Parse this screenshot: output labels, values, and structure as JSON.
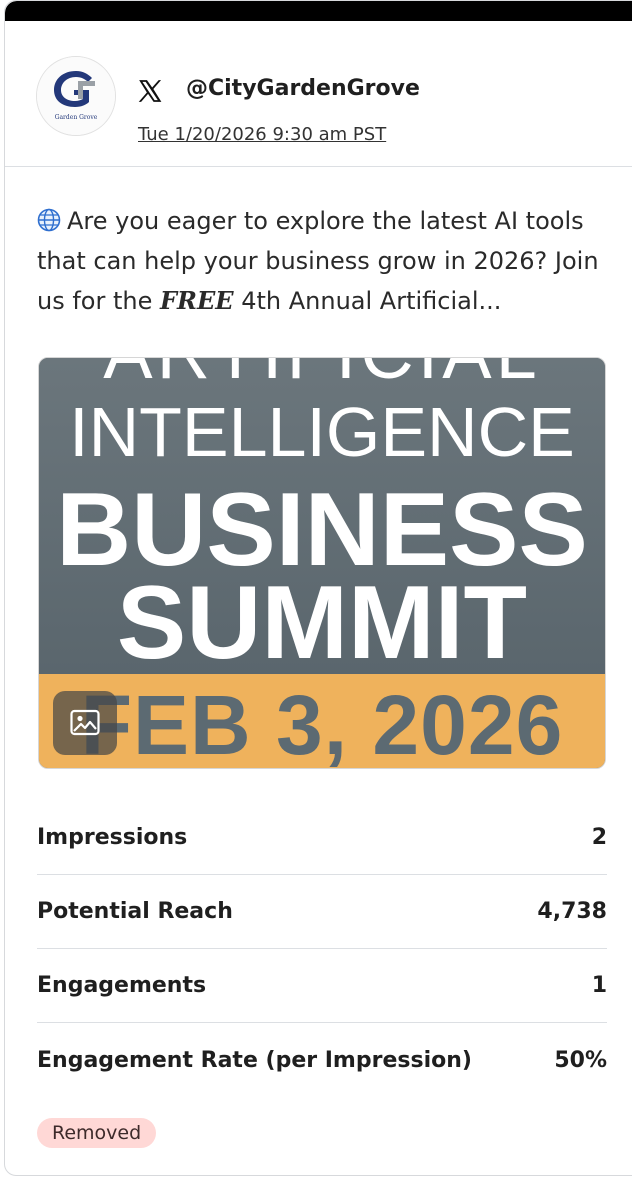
{
  "post": {
    "platform_icon": "x-logo-icon",
    "avatar": {
      "icon": "garden-grove-logo",
      "logo_text": "Garden Grove"
    },
    "handle": "@CityGardenGrove",
    "timestamp": "Tue 1/20/2026 9:30 am PST",
    "text_part1": "Are you eager to explore the latest AI tools that can help your business grow in 2026? Join us for the ",
    "text_free": "FREE",
    "text_part2": " 4th Annual Artificial...",
    "text_icon": "globe-icon"
  },
  "media": {
    "lines": [
      "ARTIFICIAL",
      "INTELLIGENCE",
      "BUSINESS",
      "SUMMIT",
      "FEB 3, 2026"
    ],
    "badge_icon": "image-icon",
    "colors": {
      "top": "#5e6b72",
      "bottom": "#efb25c"
    }
  },
  "stats": [
    {
      "label": "Impressions",
      "value": "2"
    },
    {
      "label": "Potential Reach",
      "value": "4,738"
    },
    {
      "label": "Engagements",
      "value": "1"
    },
    {
      "label": "Engagement Rate (per Impression)",
      "value": "50%"
    }
  ],
  "status": {
    "label": "Removed",
    "color": "#ffd8d6"
  }
}
